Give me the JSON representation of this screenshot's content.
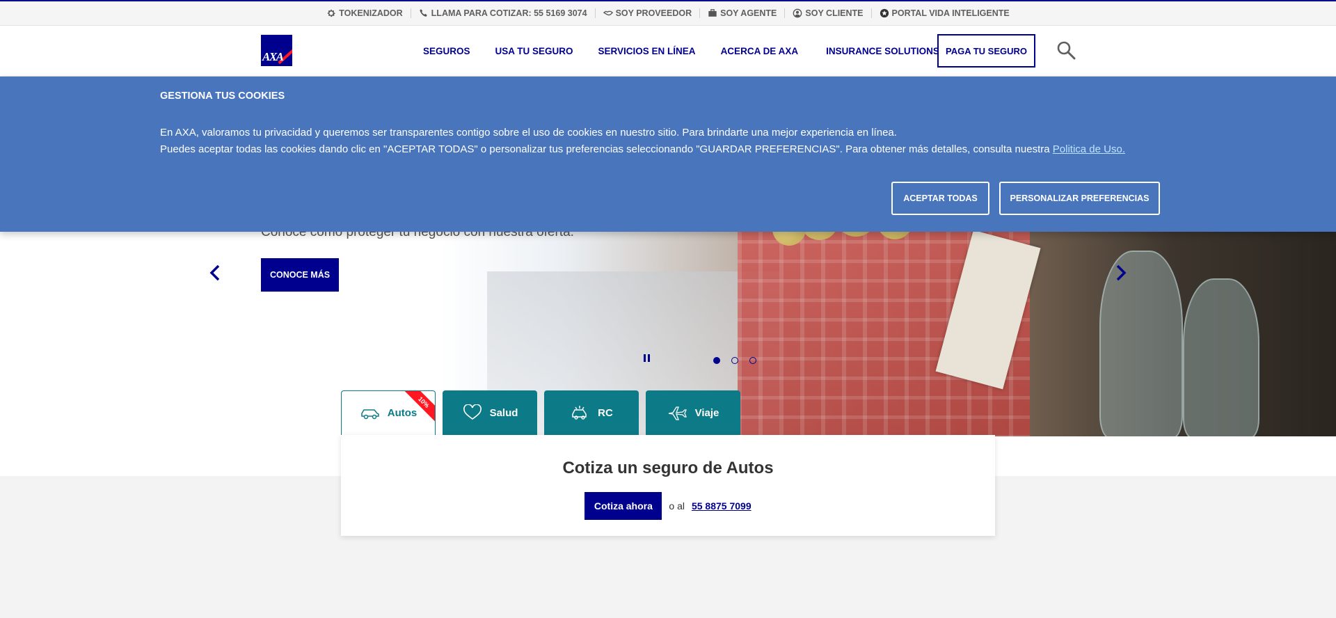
{
  "topbar": {
    "items": [
      {
        "label": "TOKENIZADOR",
        "icon": "gear-icon"
      },
      {
        "label": "LLAMA PARA COTIZAR: 55 5169 3074",
        "icon": "phone-icon"
      },
      {
        "label": "SOY PROVEEDOR",
        "icon": "handshake-icon"
      },
      {
        "label": "SOY AGENTE",
        "icon": "briefcase-icon"
      },
      {
        "label": "SOY CLIENTE",
        "icon": "user-circle-icon"
      },
      {
        "label": "PORTAL VIDA INTELIGENTE",
        "icon": "star-circle-icon"
      }
    ]
  },
  "header": {
    "logo_text": "AXA",
    "nav": [
      {
        "label": "SEGUROS"
      },
      {
        "label": "USA TU SEGURO"
      },
      {
        "label": "SERVICIOS EN LÍNEA"
      },
      {
        "label": "ACERCA DE AXA"
      },
      {
        "label": "INSURANCE SOLUTIONS"
      }
    ],
    "pay_button": "PAGA TU SEGURO"
  },
  "cookie_banner": {
    "title": "GESTIONA TUS COOKIES",
    "paragraph_1": "En AXA, valoramos tu privacidad y queremos ser transparentes contigo sobre el uso de cookies en nuestro sitio. Para brindarte una mejor experiencia en línea.",
    "paragraph_2": "Puedes aceptar todas las cookies dando clic en \"ACEPTAR TODAS\" o personalizar tus preferencias seleccionando \"GUARDAR PREFERENCIAS\". Para obtener más detalles, consulta nuestra",
    "link": "Politica de Uso.",
    "accept_button": "ACEPTAR TODAS",
    "customize_button": "PERSONALIZAR PREFERENCIAS"
  },
  "hero": {
    "subtitle": "Conoce cómo proteger tu negocio con nuestra oferta.",
    "cta": "CONOCE MÁS",
    "active_slide": 1,
    "slide_count": 3
  },
  "product_tabs": [
    {
      "label": "Autos",
      "icon": "car-icon",
      "active": true,
      "badge": "10%"
    },
    {
      "label": "Salud",
      "icon": "heart-icon",
      "active": false
    },
    {
      "label": "RC",
      "icon": "car-crash-icon",
      "active": false
    },
    {
      "label": "Viaje",
      "icon": "airplane-icon",
      "active": false
    }
  ],
  "quote": {
    "title": "Cotiza un seguro de Autos",
    "button": "Cotiza ahora",
    "or_text": "o al",
    "phone": "55 8875 7099"
  },
  "colors": {
    "brand_blue": "#00008f",
    "cookie_blue": "#4975bd",
    "teal": "#0d7a87",
    "red": "#ff1721"
  }
}
